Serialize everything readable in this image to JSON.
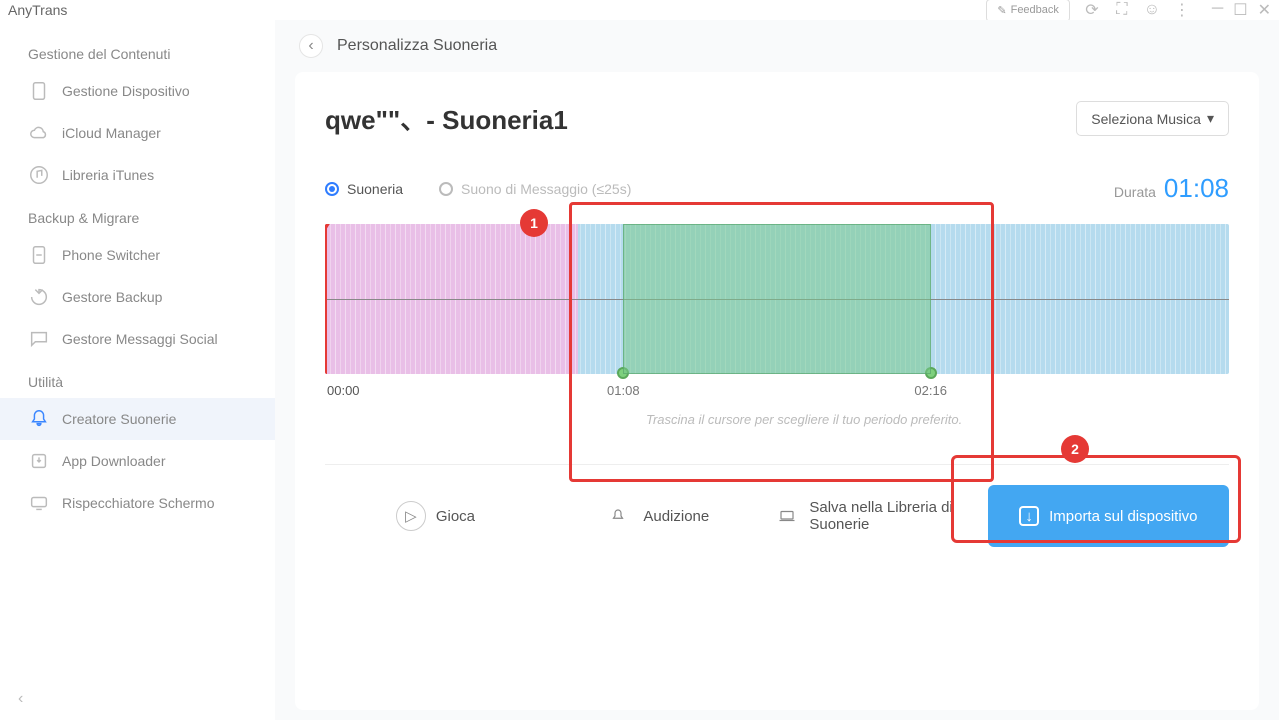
{
  "app_name": "AnyTrans",
  "topbar": {
    "feedback": "Feedback"
  },
  "sidebar": {
    "sections": {
      "content": "Gestione del Contenuti",
      "backup": "Backup & Migrare",
      "utility": "Utilità"
    },
    "items": {
      "device_manager": "Gestione Dispositivo",
      "icloud": "iCloud Manager",
      "itunes": "Libreria iTunes",
      "phone_switcher": "Phone Switcher",
      "backup_manager": "Gestore Backup",
      "social_messages": "Gestore Messaggi Social",
      "ringtone_maker": "Creatore Suonerie",
      "app_downloader": "App Downloader",
      "screen_mirror": "Rispecchiatore Schermo"
    }
  },
  "breadcrumb": "Personalizza Suoneria",
  "song_title": "qwe\"\"、- Suoneria1",
  "select_music": "Seleziona Musica",
  "type_options": {
    "ringtone": "Suoneria",
    "message": "Suono di Messaggio (≤25s)"
  },
  "duration": {
    "label": "Durata",
    "value": "01:08"
  },
  "timeline": {
    "playhead": "00:00",
    "sel_start": "01:08",
    "sel_end": "02:16",
    "hint": "Trascina il cursore per scegliere il tuo periodo preferito."
  },
  "actions": {
    "play": "Gioca",
    "audition": "Audizione",
    "save_library": "Salva nella Libreria di Suonerie",
    "import_device": "Importa sul dispositivo"
  },
  "annotations": {
    "b1": "1",
    "b2": "2"
  }
}
